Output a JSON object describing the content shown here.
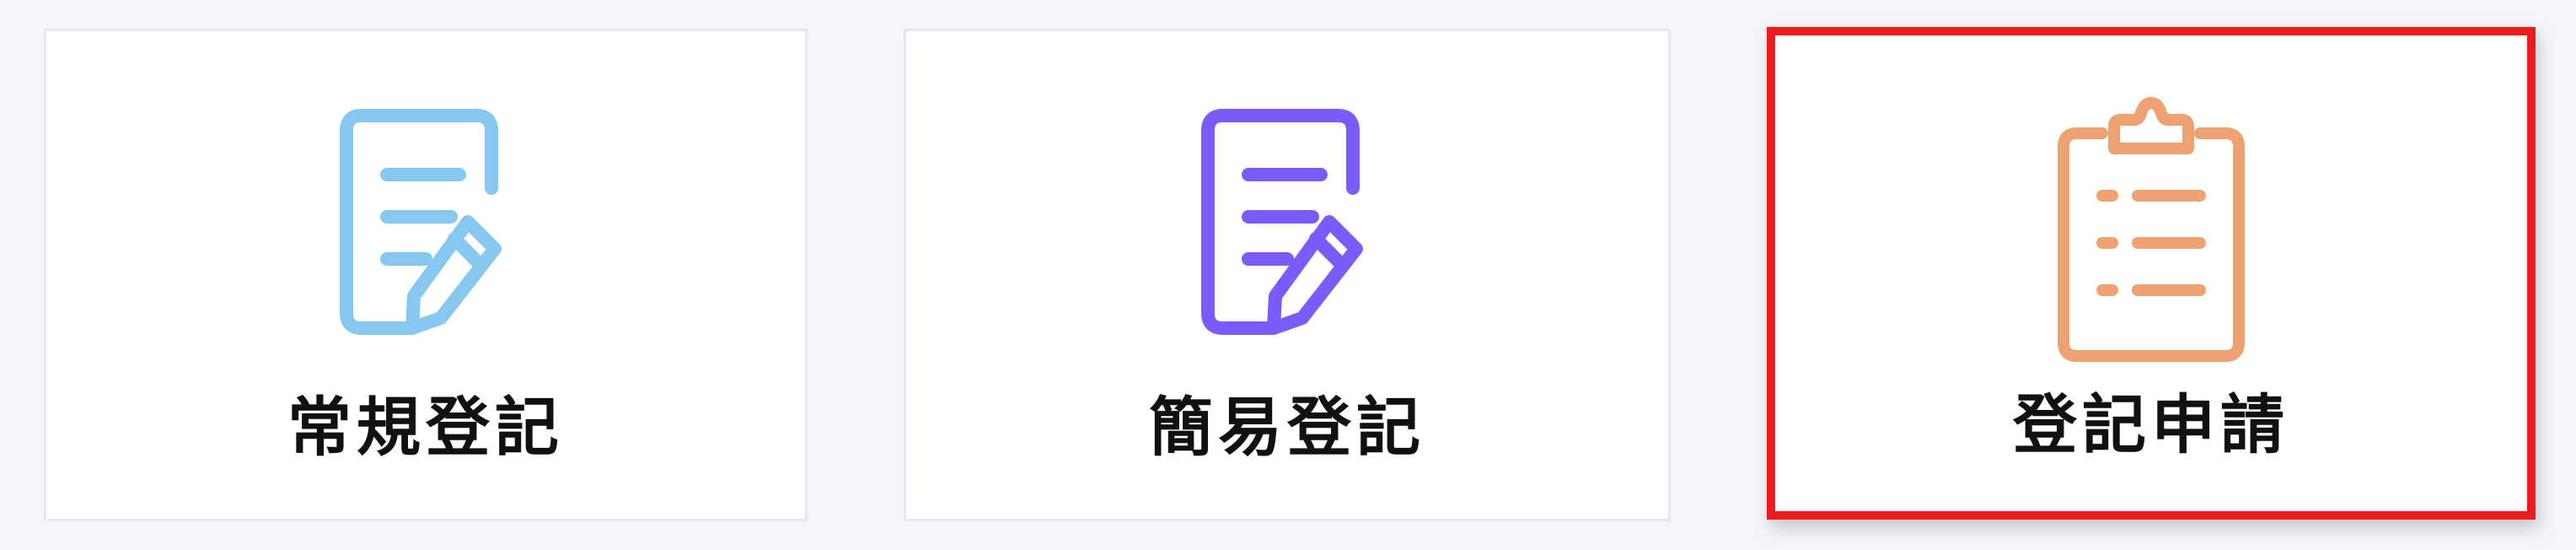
{
  "cards": [
    {
      "label": "常規登記",
      "icon": "document-edit-icon",
      "icon_color": "#86c8ef"
    },
    {
      "label": "簡易登記",
      "icon": "document-edit-icon",
      "icon_color": "#7b5cfb"
    },
    {
      "label": "登記申請",
      "icon": "clipboard-list-icon",
      "icon_color": "#eea271",
      "highlight_color": "#ec1c1c",
      "highlighted": true
    }
  ]
}
